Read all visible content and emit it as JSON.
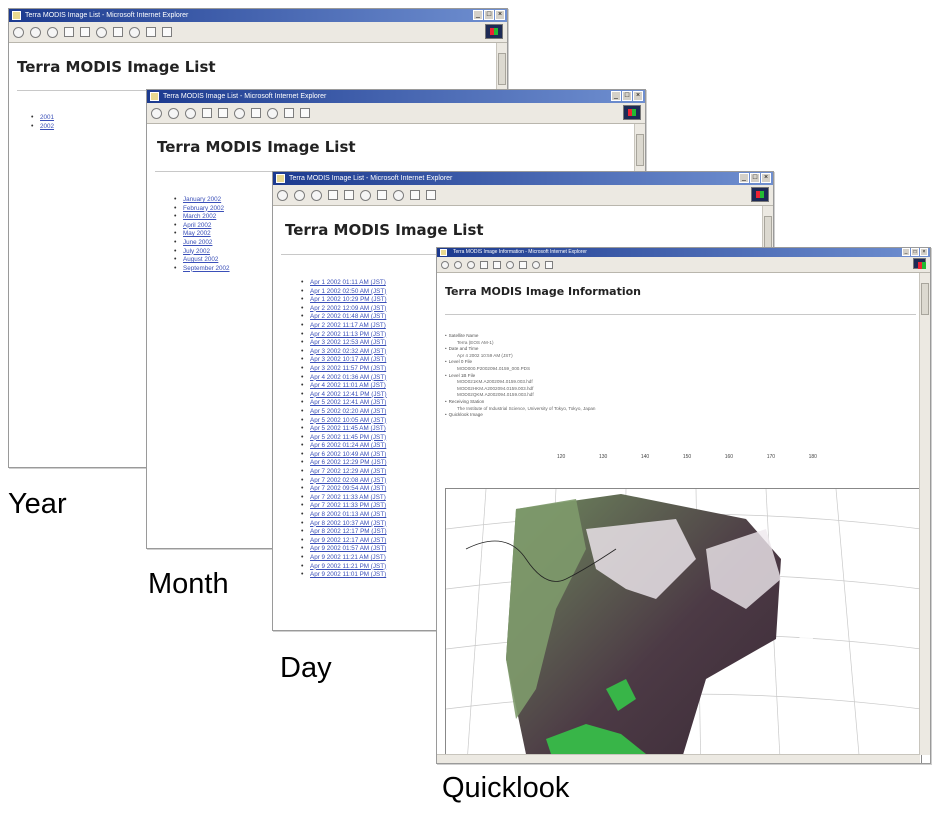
{
  "captions": {
    "year": "Year",
    "month": "Month",
    "day": "Day",
    "quicklook": "Quicklook"
  },
  "window_year": {
    "title": "Terra MODIS Image List - Microsoft Internet Explorer",
    "page_title": "Terra MODIS Image List",
    "items": [
      "2001",
      "2002"
    ]
  },
  "window_month": {
    "title": "Terra MODIS Image List - Microsoft Internet Explorer",
    "page_title": "Terra MODIS Image List",
    "items": [
      "January 2002",
      "February 2002",
      "March 2002",
      "April 2002",
      "May 2002",
      "June 2002",
      "July 2002",
      "August 2002",
      "September 2002"
    ]
  },
  "window_day": {
    "title": "Terra MODIS Image List - Microsoft Internet Explorer",
    "page_title": "Terra MODIS Image List",
    "items": [
      "Apr 1 2002 01:11 AM (JST)",
      "Apr 1 2002 02:50 AM (JST)",
      "Apr 1 2002 10:29 PM (JST)",
      "Apr 2 2002 12:09 AM (JST)",
      "Apr 2 2002 01:48 AM (JST)",
      "Apr 2 2002 11:17 AM (JST)",
      "Apr 2 2002 11:13 PM (JST)",
      "Apr 3 2002 12:53 AM (JST)",
      "Apr 3 2002 02:32 AM (JST)",
      "Apr 3 2002 10:17 AM (JST)",
      "Apr 3 2002 11:57 PM (JST)",
      "Apr 4 2002 01:36 AM (JST)",
      "Apr 4 2002 11:01 AM (JST)",
      "Apr 4 2002 12:41 PM (JST)",
      "Apr 5 2002 12:41 AM (JST)",
      "Apr 5 2002 02:20 AM (JST)",
      "Apr 5 2002 10:05 AM (JST)",
      "Apr 5 2002 11:45 AM (JST)",
      "Apr 5 2002 11:45 PM (JST)",
      "Apr 6 2002 01:24 AM (JST)",
      "Apr 6 2002 10:49 AM (JST)",
      "Apr 6 2002 12:29 PM (JST)",
      "Apr 7 2002 12:29 AM (JST)",
      "Apr 7 2002 02:08 AM (JST)",
      "Apr 7 2002 09:54 AM (JST)",
      "Apr 7 2002 11:33 AM (JST)",
      "Apr 7 2002 11:33 PM (JST)",
      "Apr 8 2002 01:13 AM (JST)",
      "Apr 8 2002 10:37 AM (JST)",
      "Apr 8 2002 12:17 PM (JST)",
      "Apr 9 2002 12:17 AM (JST)",
      "Apr 9 2002 01:57 AM (JST)",
      "Apr 9 2002 11:21 AM (JST)",
      "Apr 9 2002 11:21 PM (JST)",
      "Apr 9 2002 11:01 PM (JST)"
    ]
  },
  "window_quicklook": {
    "title": "Terra MODIS Image Information - Microsoft Internet Explorer",
    "page_title": "Terra MODIS Image Information",
    "info": [
      {
        "label": "Satellite Name",
        "values": [
          "Terra (EOS AM-1)"
        ]
      },
      {
        "label": "Date and Time",
        "values": [
          "Apr 4 2002 10:59 AM (JST)"
        ]
      },
      {
        "label": "Level 0 File",
        "values": [
          "MOD000.P2002094.0159_000.PDS"
        ]
      },
      {
        "label": "Level 1B File",
        "values": [
          "MOD021KM.A2002094.0159.003.hdf",
          "MOD02HKM.A2002094.0159.003.hdf",
          "MOD02QKM.A2002094.0159.003.hdf"
        ]
      },
      {
        "label": "Receiving Station",
        "values": [
          "The Institute of Industrial Science, University of Tokyo, Tokyo, Japan"
        ]
      },
      {
        "label": "Quicklook Image",
        "values": []
      }
    ],
    "map_lon_labels": [
      "120",
      "130",
      "140",
      "150",
      "160",
      "170",
      "180"
    ]
  }
}
